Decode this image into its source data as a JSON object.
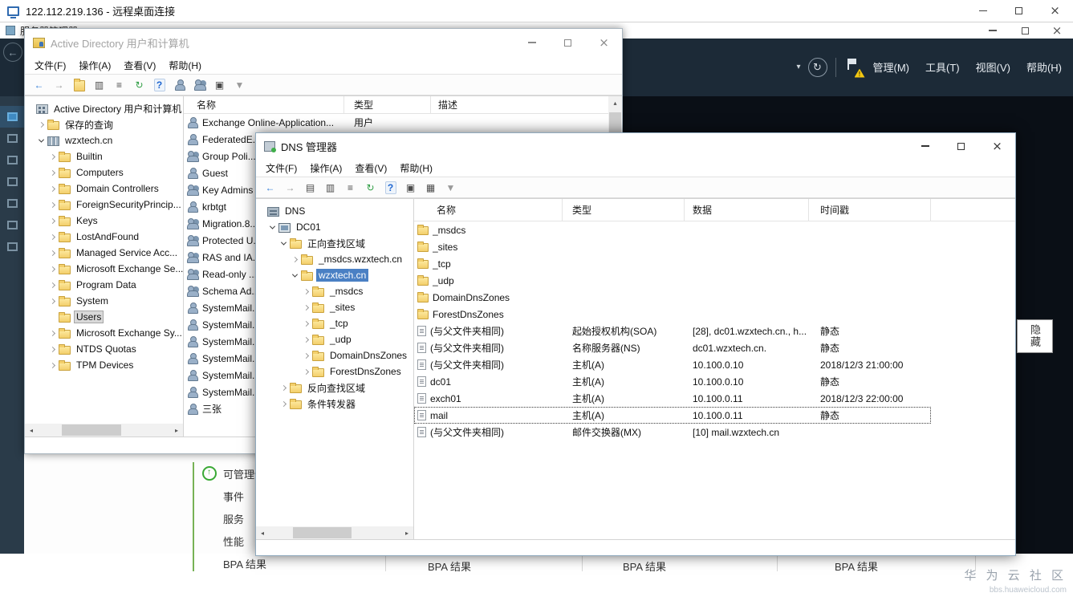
{
  "rdp": {
    "title": "122.112.219.136 - 远程桌面连接"
  },
  "server_manager": {
    "title": "服务器管理器",
    "menu": [
      {
        "label": "管理(M)"
      },
      {
        "label": "工具(T)"
      },
      {
        "label": "视图(V)"
      },
      {
        "label": "帮助(H)"
      }
    ],
    "sidebar": [
      {
        "icon": "dashboard",
        "selected": true
      },
      {
        "icon": "local-server"
      },
      {
        "icon": "all-servers"
      },
      {
        "icon": "ad-ds"
      },
      {
        "icon": "dns-role"
      },
      {
        "icon": "file-storage"
      },
      {
        "icon": "iis"
      }
    ],
    "tile_rows": [
      {
        "label": "可管理性",
        "icon": "manageability"
      },
      {
        "label": "事件"
      },
      {
        "label": "服务"
      },
      {
        "label": "性能"
      },
      {
        "label": "BPA 结果"
      }
    ],
    "bpa_label": "BPA 结果",
    "hide_tab": "隐藏"
  },
  "ad": {
    "title": "Active Directory 用户和计算机",
    "menu": [
      {
        "label": "文件(F)"
      },
      {
        "label": "操作(A)"
      },
      {
        "label": "查看(V)"
      },
      {
        "label": "帮助(H)"
      }
    ],
    "toolbar": [
      {
        "name": "back-icon",
        "glyph": "←",
        "cls": "tb-blue"
      },
      {
        "name": "forward-icon",
        "glyph": "→",
        "cls": "tb-dim"
      },
      {
        "name": "up-one-level-icon",
        "icon": "folder"
      },
      {
        "name": "properties-icon",
        "glyph": "▥"
      },
      {
        "name": "export-list-icon",
        "glyph": "≡"
      },
      {
        "name": "refresh-icon",
        "glyph": "↻",
        "cls": "tb-green"
      },
      {
        "name": "help-icon",
        "glyph": "?",
        "cls": "tb-help"
      },
      {
        "name": "add-user-icon",
        "icon": "user"
      },
      {
        "name": "add-group-icon",
        "icon": "group"
      },
      {
        "name": "add-ou-icon",
        "glyph": "▣"
      },
      {
        "name": "filter-icon",
        "glyph": "▼",
        "cls": "tb-dim"
      }
    ],
    "columns": [
      "名称",
      "类型",
      "描述"
    ],
    "tree": [
      {
        "label": "Active Directory 用户和计算机",
        "level": 0,
        "icon": "ad-root",
        "expand": "none"
      },
      {
        "label": "保存的查询",
        "level": 1,
        "icon": "folder",
        "expand": "collapsed"
      },
      {
        "label": "wzxtech.cn",
        "level": 1,
        "icon": "domain",
        "expand": "expanded"
      },
      {
        "label": "Builtin",
        "level": 2,
        "icon": "folder",
        "expand": "collapsed"
      },
      {
        "label": "Computers",
        "level": 2,
        "icon": "folder",
        "expand": "collapsed"
      },
      {
        "label": "Domain Controllers",
        "level": 2,
        "icon": "folder",
        "expand": "collapsed"
      },
      {
        "label": "ForeignSecurityPrincip...",
        "level": 2,
        "icon": "folder",
        "expand": "collapsed"
      },
      {
        "label": "Keys",
        "level": 2,
        "icon": "folder",
        "expand": "collapsed"
      },
      {
        "label": "LostAndFound",
        "level": 2,
        "icon": "folder",
        "expand": "collapsed"
      },
      {
        "label": "Managed Service Acc...",
        "level": 2,
        "icon": "folder",
        "expand": "collapsed"
      },
      {
        "label": "Microsoft Exchange Se...",
        "level": 2,
        "icon": "folder",
        "expand": "collapsed"
      },
      {
        "label": "Program Data",
        "level": 2,
        "icon": "folder",
        "expand": "collapsed"
      },
      {
        "label": "System",
        "level": 2,
        "icon": "folder",
        "expand": "collapsed"
      },
      {
        "label": "Users",
        "level": 2,
        "icon": "folder",
        "expand": "none",
        "selected": true
      },
      {
        "label": "Microsoft Exchange Sy...",
        "level": 2,
        "icon": "folder",
        "expand": "collapsed"
      },
      {
        "label": "NTDS Quotas",
        "level": 2,
        "icon": "folder",
        "expand": "collapsed"
      },
      {
        "label": "TPM Devices",
        "level": 2,
        "icon": "folder",
        "expand": "collapsed"
      }
    ],
    "rows": [
      {
        "name": "Exchange Online-Application...",
        "type": "用户",
        "desc": "",
        "icon": "user"
      },
      {
        "name": "FederatedE...",
        "type": "",
        "desc": "",
        "icon": "user"
      },
      {
        "name": "Group Poli...",
        "type": "",
        "desc": "",
        "icon": "group"
      },
      {
        "name": "Guest",
        "type": "",
        "desc": "",
        "icon": "user"
      },
      {
        "name": "Key Admins",
        "type": "",
        "desc": "",
        "icon": "group"
      },
      {
        "name": "krbtgt",
        "type": "",
        "desc": "",
        "icon": "user"
      },
      {
        "name": "Migration.8...",
        "type": "",
        "desc": "",
        "icon": "group"
      },
      {
        "name": "Protected U...",
        "type": "",
        "desc": "",
        "icon": "group"
      },
      {
        "name": "RAS and IA...",
        "type": "",
        "desc": "",
        "icon": "group"
      },
      {
        "name": "Read-only ...",
        "type": "",
        "desc": "",
        "icon": "group"
      },
      {
        "name": "Schema Ad...",
        "type": "",
        "desc": "",
        "icon": "group"
      },
      {
        "name": "SystemMail...",
        "type": "",
        "desc": "",
        "icon": "user"
      },
      {
        "name": "SystemMail...",
        "type": "",
        "desc": "",
        "icon": "user"
      },
      {
        "name": "SystemMail...",
        "type": "",
        "desc": "",
        "icon": "user"
      },
      {
        "name": "SystemMail...",
        "type": "",
        "desc": "",
        "icon": "user"
      },
      {
        "name": "SystemMail...",
        "type": "",
        "desc": "",
        "icon": "user"
      },
      {
        "name": "SystemMail...",
        "type": "",
        "desc": "",
        "icon": "user"
      },
      {
        "name": "三张",
        "type": "",
        "desc": "",
        "icon": "user"
      }
    ]
  },
  "dns": {
    "title": "DNS 管理器",
    "menu": [
      {
        "label": "文件(F)"
      },
      {
        "label": "操作(A)"
      },
      {
        "label": "查看(V)"
      },
      {
        "label": "帮助(H)"
      }
    ],
    "toolbar": [
      {
        "name": "back-icon",
        "glyph": "←",
        "cls": "tb-blue"
      },
      {
        "name": "forward-icon",
        "glyph": "→",
        "cls": "tb-dim"
      },
      {
        "name": "show-console-tree-icon",
        "glyph": "▤"
      },
      {
        "name": "properties-icon",
        "glyph": "▥"
      },
      {
        "name": "export-list-icon",
        "glyph": "≡"
      },
      {
        "name": "refresh-icon",
        "glyph": "↻",
        "cls": "tb-green"
      },
      {
        "name": "help-icon",
        "glyph": "?",
        "cls": "tb-help"
      },
      {
        "name": "new-record-icon",
        "glyph": "▣"
      },
      {
        "name": "list-view-icon",
        "glyph": "▦"
      },
      {
        "name": "filter-icon",
        "glyph": "▼",
        "cls": "tb-dim"
      }
    ],
    "columns": [
      "名称",
      "类型",
      "数据",
      "时间戳"
    ],
    "tree": [
      {
        "label": "DNS",
        "level": 0,
        "icon": "dns",
        "expand": "none"
      },
      {
        "label": "DC01",
        "level": 1,
        "icon": "server",
        "expand": "expanded"
      },
      {
        "label": "正向查找区域",
        "level": 2,
        "icon": "folder",
        "expand": "expanded"
      },
      {
        "label": "_msdcs.wzxtech.cn",
        "level": 3,
        "icon": "zone",
        "expand": "collapsed"
      },
      {
        "label": "wzxtech.cn",
        "level": 3,
        "icon": "zone",
        "expand": "expanded",
        "selected": true
      },
      {
        "label": "_msdcs",
        "level": 4,
        "icon": "folder",
        "expand": "collapsed"
      },
      {
        "label": "_sites",
        "level": 4,
        "icon": "folder",
        "expand": "collapsed"
      },
      {
        "label": "_tcp",
        "level": 4,
        "icon": "folder",
        "expand": "collapsed"
      },
      {
        "label": "_udp",
        "level": 4,
        "icon": "folder",
        "expand": "collapsed"
      },
      {
        "label": "DomainDnsZones",
        "level": 4,
        "icon": "folder",
        "expand": "collapsed"
      },
      {
        "label": "ForestDnsZones",
        "level": 4,
        "icon": "folder",
        "expand": "collapsed"
      },
      {
        "label": "反向查找区域",
        "level": 2,
        "icon": "folder",
        "expand": "collapsed"
      },
      {
        "label": "条件转发器",
        "level": 2,
        "icon": "folder",
        "expand": "collapsed"
      }
    ],
    "rows": [
      {
        "name": "_msdcs",
        "type": "",
        "data": "",
        "ts": "",
        "icon": "folder"
      },
      {
        "name": "_sites",
        "type": "",
        "data": "",
        "ts": "",
        "icon": "folder"
      },
      {
        "name": "_tcp",
        "type": "",
        "data": "",
        "ts": "",
        "icon": "folder"
      },
      {
        "name": "_udp",
        "type": "",
        "data": "",
        "ts": "",
        "icon": "folder"
      },
      {
        "name": "DomainDnsZones",
        "type": "",
        "data": "",
        "ts": "",
        "icon": "folder"
      },
      {
        "name": "ForestDnsZones",
        "type": "",
        "data": "",
        "ts": "",
        "icon": "folder"
      },
      {
        "name": "(与父文件夹相同)",
        "type": "起始授权机构(SOA)",
        "data": "[28], dc01.wzxtech.cn., h...",
        "ts": "静态",
        "icon": "record"
      },
      {
        "name": "(与父文件夹相同)",
        "type": "名称服务器(NS)",
        "data": "dc01.wzxtech.cn.",
        "ts": "静态",
        "icon": "record"
      },
      {
        "name": "(与父文件夹相同)",
        "type": "主机(A)",
        "data": "10.100.0.10",
        "ts": "2018/12/3 21:00:00",
        "icon": "record"
      },
      {
        "name": "dc01",
        "type": "主机(A)",
        "data": "10.100.0.10",
        "ts": "静态",
        "icon": "record"
      },
      {
        "name": "exch01",
        "type": "主机(A)",
        "data": "10.100.0.11",
        "ts": "2018/12/3 22:00:00",
        "icon": "record"
      },
      {
        "name": "mail",
        "type": "主机(A)",
        "data": "10.100.0.11",
        "ts": "静态",
        "icon": "record",
        "selected": true
      },
      {
        "name": "(与父文件夹相同)",
        "type": "邮件交换器(MX)",
        "data": "[10]  mail.wzxtech.cn",
        "ts": "",
        "icon": "record"
      }
    ]
  },
  "watermark": {
    "line1": "华 为 云 社 区",
    "line2": "bbs.huaweicloud.com"
  }
}
